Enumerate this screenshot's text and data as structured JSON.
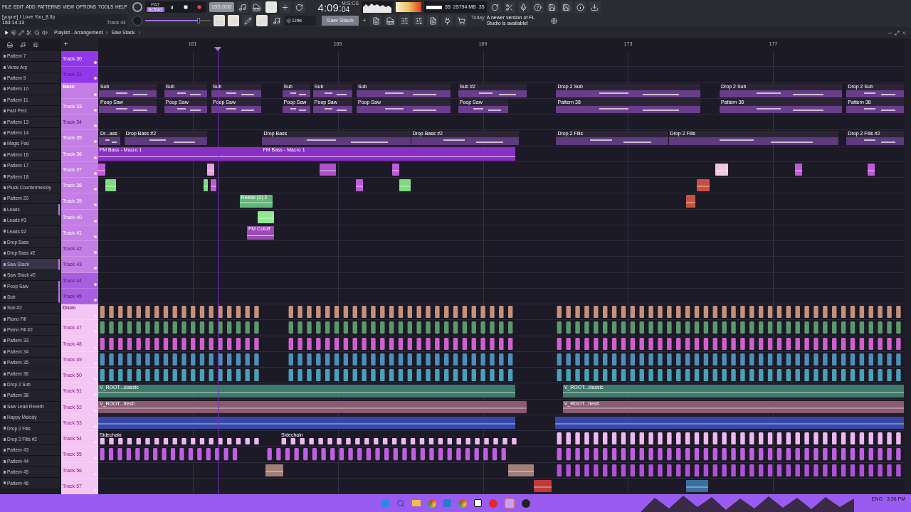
{
  "menu": [
    "FILE",
    "EDIT",
    "ADD",
    "PATTERNS",
    "VIEW",
    "OPTIONS",
    "TOOLS",
    "HELP"
  ],
  "transport": {
    "modes": [
      {
        "label": "PAT",
        "selected": false
      },
      {
        "label": "SONG",
        "selected": true
      }
    ],
    "tempo": "155.000",
    "clock": "4:09:",
    "clock_cs": "04",
    "clock_unit": "M:S:CS",
    "cpu": "35",
    "memory": "25794 MB",
    "polyphony": "35"
  },
  "project": {
    "slider": {
      "level": 0.82
    },
    "file": "[yuyue] I Love You_8.flp",
    "position": "163:14:13",
    "track": "Track 44",
    "snap": "Line",
    "pattern": "Saw Stack",
    "add": "+",
    "news_day": "Today",
    "news": "A newer version of FL Studio is available!"
  },
  "playlist": {
    "title": "Playlist - Arrangement",
    "pattern": "Saw Stack",
    "add": "+",
    "ruler": [
      "161",
      "165",
      "169",
      "173",
      "177"
    ]
  },
  "patterns": [
    {
      "name": "Pattern 7",
      "selected": false,
      "marked": false
    },
    {
      "name": "Verse Arp",
      "selected": false,
      "marked": false
    },
    {
      "name": "Pattern 9",
      "selected": false,
      "marked": false
    },
    {
      "name": "Pattern 10",
      "selected": false,
      "marked": false
    },
    {
      "name": "Pattern 11",
      "selected": false,
      "marked": false
    },
    {
      "name": "Fast Perc",
      "selected": false,
      "marked": false
    },
    {
      "name": "Pattern 13",
      "selected": false,
      "marked": false
    },
    {
      "name": "Pattern 14",
      "selected": false,
      "marked": false
    },
    {
      "name": "Magic Pad",
      "selected": false,
      "marked": false
    },
    {
      "name": "Pattern 16",
      "selected": false,
      "marked": false
    },
    {
      "name": "Pattern 17",
      "selected": false,
      "marked": false
    },
    {
      "name": "Pattern 18",
      "selected": false,
      "marked": false
    },
    {
      "name": "Pluck Countermelody",
      "selected": false,
      "marked": false
    },
    {
      "name": "Pattern 20",
      "selected": false,
      "marked": false
    },
    {
      "name": "Leads",
      "selected": false,
      "marked": true
    },
    {
      "name": "Leads #3",
      "selected": false,
      "marked": false
    },
    {
      "name": "Leads #2",
      "selected": false,
      "marked": false
    },
    {
      "name": "Drop Bass",
      "selected": false,
      "marked": false
    },
    {
      "name": "Drop Bass #2",
      "selected": false,
      "marked": false
    },
    {
      "name": "Saw Stack",
      "selected": true,
      "marked": true
    },
    {
      "name": "Saw Stack #2",
      "selected": false,
      "marked": false
    },
    {
      "name": "Poop Saw",
      "selected": false,
      "marked": true
    },
    {
      "name": "Sub",
      "selected": false,
      "marked": true
    },
    {
      "name": "Sub #2",
      "selected": false,
      "marked": false
    },
    {
      "name": "Piano Fill",
      "selected": false,
      "marked": false
    },
    {
      "name": "Piano Fill #2",
      "selected": false,
      "marked": false
    },
    {
      "name": "Pattern 33",
      "selected": false,
      "marked": false
    },
    {
      "name": "Pattern 34",
      "selected": false,
      "marked": false
    },
    {
      "name": "Pattern 35",
      "selected": false,
      "marked": false
    },
    {
      "name": "Pattern 36",
      "selected": false,
      "marked": false
    },
    {
      "name": "Drop 2 Sub",
      "selected": false,
      "marked": false
    },
    {
      "name": "Pattern 38",
      "selected": false,
      "marked": false
    },
    {
      "name": "Saw Lead Reverb",
      "selected": false,
      "marked": false
    },
    {
      "name": "Happy Melody",
      "selected": false,
      "marked": false
    },
    {
      "name": "Drop 2 Fills",
      "selected": false,
      "marked": false
    },
    {
      "name": "Drop 2 Fills #2",
      "selected": false,
      "marked": false
    },
    {
      "name": "Pattern 43",
      "selected": false,
      "marked": false
    },
    {
      "name": "Pattern 44",
      "selected": false,
      "marked": false
    },
    {
      "name": "Pattern 45",
      "selected": false,
      "marked": false
    },
    {
      "name": "Pattern 46",
      "selected": false,
      "marked": false
    }
  ],
  "tracks": [
    {
      "name": "Track 30",
      "kind": "track",
      "color": "#9238e8",
      "dimmed": false
    },
    {
      "name": "Track 31",
      "kind": "track",
      "color": "#9238e8",
      "dimmed": true
    },
    {
      "name": "Bass",
      "kind": "group",
      "color": "#c47ee6",
      "dimmed": false,
      "clips": [
        {
          "label": "Sub",
          "kind": "pattern",
          "color": "#6a3d8c"
        },
        {
          "label": "Sub",
          "kind": "pattern",
          "color": "#6a3d8c"
        },
        {
          "label": "Sub",
          "kind": "pattern",
          "color": "#6a3d8c"
        },
        {
          "label": "Sub",
          "kind": "pattern",
          "color": "#6a3d8c"
        },
        {
          "label": "Sub",
          "kind": "pattern",
          "color": "#6a3d8c"
        },
        {
          "label": "Sub",
          "kind": "pattern",
          "color": "#6a3d8c"
        },
        {
          "label": "Sub #2",
          "kind": "pattern",
          "color": "#6a3d8c"
        },
        {
          "label": "Drop 2 Sub",
          "kind": "pattern",
          "color": "#6a3d8c"
        },
        {
          "label": "Drop 2 Sub",
          "kind": "pattern",
          "color": "#6a3d8c"
        },
        {
          "label": "Drop 2 Sub",
          "kind": "pattern",
          "color": "#6a3d8c"
        }
      ]
    },
    {
      "name": "Track 33",
      "kind": "track",
      "color": "#c47ee6",
      "dimmed": false,
      "clips": [
        {
          "label": "Poop Saw",
          "kind": "pattern",
          "color": "#6a3d8c"
        },
        {
          "label": "Poop Saw",
          "kind": "pattern",
          "color": "#6a3d8c"
        },
        {
          "label": "Poop Saw",
          "kind": "pattern",
          "color": "#6a3d8c"
        },
        {
          "label": "Poop Saw",
          "kind": "pattern",
          "color": "#6a3d8c"
        },
        {
          "label": "Poop Saw",
          "kind": "pattern",
          "color": "#6a3d8c"
        },
        {
          "label": "Poop Saw",
          "kind": "pattern",
          "color": "#6a3d8c"
        },
        {
          "label": "Poop Saw",
          "kind": "pattern",
          "color": "#6a3d8c"
        },
        {
          "label": "Pattern 38",
          "kind": "pattern",
          "color": "#6a3d8c"
        },
        {
          "label": "Pattern 38",
          "kind": "pattern",
          "color": "#6a3d8c"
        },
        {
          "label": "Pattern 38",
          "kind": "pattern",
          "color": "#6a3d8c"
        }
      ]
    },
    {
      "name": "Track 34",
      "kind": "track",
      "color": "#c47ee6",
      "dimmed": true
    },
    {
      "name": "Track 35",
      "kind": "track",
      "color": "#c47ee6",
      "dimmed": false,
      "clips": [
        {
          "label": "Dr...ass",
          "kind": "pattern",
          "color": "#5e3a7e"
        },
        {
          "label": "Drop Bass #2",
          "kind": "pattern",
          "color": "#5e3a7e"
        },
        {
          "label": "Drop Bass",
          "kind": "pattern",
          "color": "#5e3a7e"
        },
        {
          "label": "Drop Bass #2",
          "kind": "pattern",
          "color": "#5e3a7e"
        },
        {
          "label": "Drop 2 Fills",
          "kind": "pattern",
          "color": "#5e3a7e"
        },
        {
          "label": "Drop 2 Fills",
          "kind": "pattern",
          "color": "#5e3a7e"
        },
        {
          "label": "Drop 2 Fills #2",
          "kind": "pattern",
          "color": "#5e3a7e"
        }
      ]
    },
    {
      "name": "Track 36",
      "kind": "track",
      "color": "#c47ee6",
      "dimmed": false,
      "clips": [
        {
          "label": "FM Bass - Macro 1",
          "kind": "automation",
          "color": "#8a2fc4"
        },
        {
          "label": "FM Bass - Macro 1",
          "kind": "automation",
          "color": "#8a2fc4"
        }
      ]
    },
    {
      "name": "Track 37",
      "kind": "track",
      "color": "#c47ee6",
      "dimmed": false,
      "clips": [
        {
          "kind": "audio",
          "color": "#c05ad8"
        },
        {
          "kind": "audio",
          "color": "#e8a0e8"
        },
        {
          "kind": "audio",
          "color": "#b050c8"
        },
        {
          "kind": "audio",
          "color": "#c05ad8"
        },
        {
          "kind": "audio",
          "color": "#f0c8e0"
        },
        {
          "kind": "audio",
          "color": "#c05ad8"
        },
        {
          "kind": "audio",
          "color": "#c05ad8"
        }
      ]
    },
    {
      "name": "Track 38",
      "kind": "track",
      "color": "#c47ee6",
      "dimmed": false,
      "clips": [
        {
          "kind": "audio",
          "color": "#7ddc7d"
        },
        {
          "kind": "audio",
          "color": "#7ddc7d"
        },
        {
          "kind": "audio",
          "color": "#c05ad8"
        },
        {
          "kind": "audio",
          "color": "#c05ad8"
        },
        {
          "kind": "audio",
          "color": "#7ddc7d"
        },
        {
          "kind": "audio",
          "color": "#c85040"
        }
      ]
    },
    {
      "name": "Track 39",
      "kind": "track",
      "color": "#c47ee6",
      "dimmed": false,
      "clips": [
        {
          "label": "Reese (2) 2",
          "kind": "audio",
          "color": "#5fb87a"
        },
        {
          "kind": "audio",
          "color": "#c85040"
        }
      ]
    },
    {
      "name": "Track 40",
      "kind": "track",
      "color": "#c47ee6",
      "dimmed": false,
      "clips": [
        {
          "kind": "audio",
          "color": "#8ee88e"
        }
      ]
    },
    {
      "name": "Track 41",
      "kind": "track",
      "color": "#c47ee6",
      "dimmed": false,
      "clips": [
        {
          "label": "FM Cutoff",
          "kind": "automation",
          "color": "#9a4ab0"
        }
      ]
    },
    {
      "name": "Track 42",
      "kind": "track",
      "color": "#c47ee6",
      "dimmed": true
    },
    {
      "name": "Track 43",
      "kind": "track",
      "color": "#c47ee6",
      "dimmed": true
    },
    {
      "name": "Track 44",
      "kind": "track",
      "color": "#a95ee0",
      "dimmed": true
    },
    {
      "name": "Track 45",
      "kind": "track",
      "color": "#a95ee0",
      "dimmed": true
    },
    {
      "name": "Drum",
      "kind": "group",
      "color": "#f4c6f4",
      "dimmed": false,
      "clips": [
        {
          "kind": "hits",
          "color": "#c8907a"
        },
        {
          "kind": "hits",
          "color": "#c8907a"
        },
        {
          "kind": "hits",
          "color": "#c8907a"
        }
      ]
    },
    {
      "name": "Track 47",
      "kind": "track",
      "color": "#f4c6f4",
      "dimmed": false,
      "clips": [
        {
          "kind": "hits",
          "color": "#5a9a6a"
        },
        {
          "kind": "hits",
          "color": "#5a9a6a"
        },
        {
          "kind": "hits",
          "color": "#5a9a6a"
        }
      ]
    },
    {
      "name": "Track 48",
      "kind": "track",
      "color": "#f4c6f4",
      "dimmed": false,
      "clips": [
        {
          "kind": "hits",
          "color": "#d060d0"
        },
        {
          "kind": "hits",
          "color": "#d060d0"
        },
        {
          "kind": "hits",
          "color": "#d060d0"
        }
      ]
    },
    {
      "name": "Track 49",
      "kind": "track",
      "color": "#f4c6f4",
      "dimmed": false,
      "clips": [
        {
          "kind": "hits",
          "color": "#4a90b8"
        },
        {
          "kind": "hits",
          "color": "#4a90b8"
        },
        {
          "kind": "hits",
          "color": "#4a90b8"
        }
      ]
    },
    {
      "name": "Track 50",
      "kind": "track",
      "color": "#f4c6f4",
      "dimmed": false,
      "clips": [
        {
          "kind": "hits",
          "color": "#4aa0b8"
        },
        {
          "kind": "hits",
          "color": "#4aa0b8"
        },
        {
          "kind": "hits",
          "color": "#4aa0b8"
        }
      ]
    },
    {
      "name": "Track 51",
      "kind": "track",
      "color": "#f4c6f4",
      "dimmed": false,
      "clips": [
        {
          "label": "V_ROOT...classic",
          "kind": "audio",
          "color": "#3d7a6a"
        },
        {
          "label": "V_ROOT...classic",
          "kind": "audio",
          "color": "#3d7a6a"
        }
      ]
    },
    {
      "name": "Track 52",
      "kind": "track",
      "color": "#f4c6f4",
      "dimmed": false,
      "clips": [
        {
          "label": "V_ROOT...fresh",
          "kind": "audio",
          "color": "#8a5a70"
        },
        {
          "label": "V_ROOT...fresh",
          "kind": "audio",
          "color": "#8a5a70"
        }
      ]
    },
    {
      "name": "Track 53",
      "kind": "track",
      "color": "#f4c6f4",
      "dimmed": false,
      "clips": [
        {
          "kind": "audio",
          "color": "#3848a8"
        },
        {
          "kind": "audio",
          "color": "#3848a8"
        }
      ]
    },
    {
      "name": "Track 54",
      "kind": "track",
      "color": "#f4c6f4",
      "dimmed": false,
      "clips": [
        {
          "label": "Sidechain",
          "kind": "hits",
          "color": "#f0b8f0"
        },
        {
          "label": "Sidechain",
          "kind": "hits",
          "color": "#f0b8f0"
        },
        {
          "kind": "hits",
          "color": "#f0b8f0"
        }
      ]
    },
    {
      "name": "Track 55",
      "kind": "track",
      "color": "#f4c6f4",
      "dimmed": false,
      "clips": [
        {
          "kind": "hits",
          "color": "#c060e0"
        },
        {
          "kind": "hits",
          "color": "#c060e0"
        },
        {
          "kind": "hits",
          "color": "#c060e0"
        }
      ]
    },
    {
      "name": "Track 56",
      "kind": "track",
      "color": "#f4c6f4",
      "dimmed": false,
      "clips": [
        {
          "kind": "audio",
          "color": "#a08078"
        },
        {
          "kind": "audio",
          "color": "#a08078"
        },
        {
          "kind": "hits",
          "color": "#b050d8"
        }
      ]
    },
    {
      "name": "Track 57",
      "kind": "track",
      "color": "#f4c6f4",
      "dimmed": false,
      "clips": [
        {
          "kind": "audio",
          "color": "#c03a3a"
        },
        {
          "kind": "audio",
          "color": "#3a70a0"
        }
      ]
    }
  ],
  "taskbar": {
    "language": "ENG",
    "time": "3:36 PM"
  }
}
